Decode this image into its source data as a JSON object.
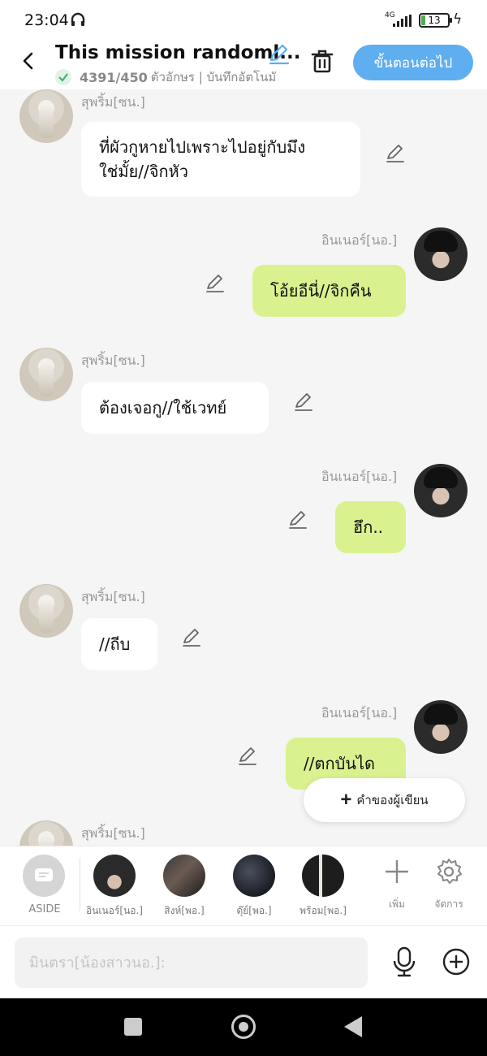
{
  "status_bar": {
    "time": "23:04",
    "network": "4G",
    "battery": "13"
  },
  "header": {
    "title": "This mission randoml...",
    "char_count": "4391/450",
    "subtitle": "ตัวอักษร | บันทึกอัตโนมั",
    "next_button": "ขั้นตอนต่อไป"
  },
  "messages": [
    {
      "side": "left",
      "sender": "สุพริ้ม[ซน.]",
      "text_lines": [
        "ที่ผัวกูหายไปเพราะไปอยู่กับมึง",
        "ใช่มั้ย//จิกหัว"
      ]
    },
    {
      "side": "right",
      "sender": "อินเนอร์[นอ.]",
      "text_lines": [
        "โอ้ยอีนี่//จิกคืน"
      ]
    },
    {
      "side": "left",
      "sender": "สุพริ้ม[ซน.]",
      "text_lines": [
        "ต้องเจอกู//ใช้เวทย์"
      ]
    },
    {
      "side": "right",
      "sender": "อินเนอร์[นอ.]",
      "text_lines": [
        "ฮึก.."
      ]
    },
    {
      "side": "left",
      "sender": "สุพริ้ม[ซน.]",
      "text_lines": [
        "//ถีบ"
      ]
    },
    {
      "side": "right",
      "sender": "อินเนอร์[นอ.]",
      "text_lines": [
        "//ตกบันได"
      ]
    },
    {
      "side": "left",
      "sender": "สุพริ้ม[ซน.]",
      "text_lines": []
    }
  ],
  "author_note_button": "คำของผู้เขียน",
  "character_bar": {
    "aside_label": "ASIDE",
    "characters": [
      {
        "name": "อินเนอร์[นอ.]"
      },
      {
        "name": "สิงห์[พอ.]"
      },
      {
        "name": "ดุ๊ย์[พอ.]"
      },
      {
        "name": "พร้อม[พอ.]"
      }
    ],
    "add_label": "เพิ่ม",
    "manage_label": "จัดการ"
  },
  "input": {
    "placeholder": "มินตรา[น้องสาวนอ.]:"
  },
  "icons": [
    "back-icon",
    "edit-icon",
    "trash-icon",
    "pencil-icon",
    "plus-icon",
    "gear-icon",
    "mic-icon",
    "plus-circle-icon",
    "check-icon",
    "headphone-icon"
  ]
}
